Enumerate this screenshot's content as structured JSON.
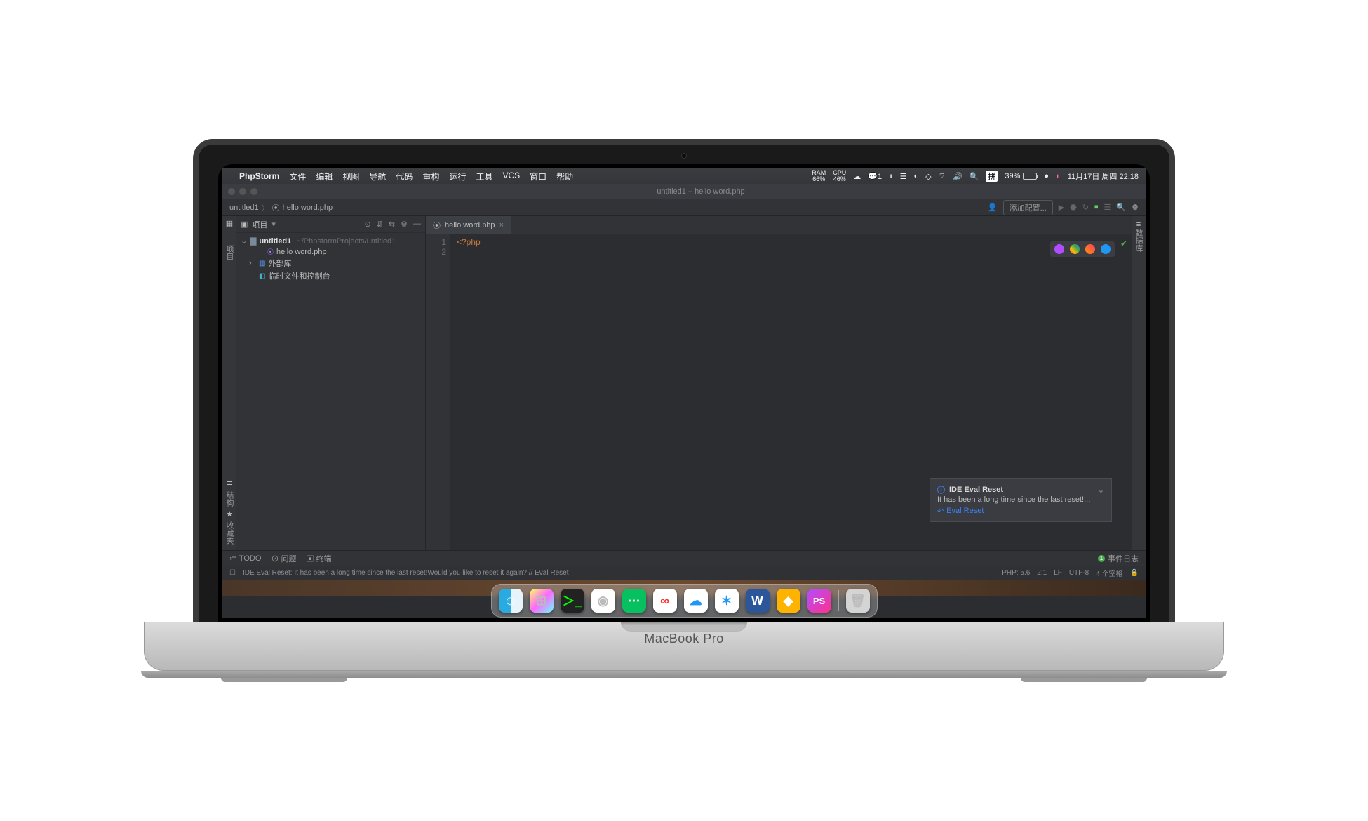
{
  "macos": {
    "appname": "PhpStorm",
    "menus": [
      "文件",
      "编辑",
      "视图",
      "导航",
      "代码",
      "重构",
      "运行",
      "工具",
      "VCS",
      "窗口",
      "帮助"
    ],
    "tray": {
      "ram_label": "RAM",
      "ram_value": "66%",
      "cpu_label": "CPU",
      "cpu_value": "46%",
      "wechat_count": "1",
      "input_method": "拼",
      "battery": "39%",
      "datetime": "11月17日 周四  22:18"
    }
  },
  "window": {
    "title": "untitled1 – hello word.php"
  },
  "breadcrumb": {
    "root": "untitled1",
    "file": "hello word.php"
  },
  "toolbar": {
    "add_config": "添加配置..."
  },
  "project_panel": {
    "title": "项目",
    "root_name": "untitled1",
    "root_path": "~/PhpstormProjects/untitled1",
    "file1": "hello word.php",
    "external_libs": "外部库",
    "scratches": "临时文件和控制台"
  },
  "left_gutter": {
    "project": "项目",
    "structure": "结构",
    "favorites": "收藏夹"
  },
  "right_gutter": {
    "database": "数据库"
  },
  "editor": {
    "tab": "hello word.php",
    "lines": [
      "1",
      "2"
    ],
    "content_line1": "<?php"
  },
  "notification": {
    "title": "IDE Eval Reset",
    "body": "It has been a long time since the last reset!...",
    "link": "Eval Reset"
  },
  "bottom_tools": {
    "todo": "TODO",
    "problems": "问题",
    "terminal": "终端",
    "event_log": "事件日志",
    "event_badge": "1"
  },
  "statusbar": {
    "message": "IDE Eval Reset: It has been a long time since the last reset!Would you like to reset it again? // Eval Reset",
    "php": "PHP: 5.6",
    "pos": "2:1",
    "le": "LF",
    "enc": "UTF-8",
    "indent": "4 个空格"
  },
  "deck": {
    "brand": "MacBook Pro"
  },
  "dock": {
    "items": [
      "finder",
      "launchpad",
      "terminal",
      "chrome",
      "wechat",
      "baidu",
      "cloud",
      "safari",
      "word",
      "sketch",
      "phpstorm"
    ],
    "trash": "trash"
  }
}
